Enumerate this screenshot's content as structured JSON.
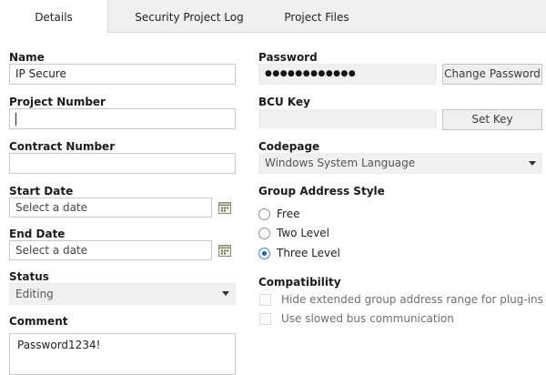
{
  "tabs": [
    {
      "label": "Details",
      "active": true
    },
    {
      "label": "Security Project Log",
      "active": false
    },
    {
      "label": "Project Files",
      "active": false
    }
  ],
  "left": {
    "name_label": "Name",
    "name_value": "IP Secure",
    "project_number_label": "Project Number",
    "project_number_value": "",
    "contract_number_label": "Contract Number",
    "contract_number_value": "",
    "start_date_label": "Start Date",
    "start_date_placeholder": "Select a date",
    "end_date_label": "End Date",
    "end_date_placeholder": "Select a date",
    "status_label": "Status",
    "status_value": "Editing",
    "comment_label": "Comment",
    "comment_value": "Password1234!"
  },
  "right": {
    "password_label": "Password",
    "password_mask": "●●●●●●●●●●●●",
    "change_password_button": "Change Password",
    "bcu_key_label": "BCU Key",
    "bcu_key_value": "",
    "set_key_button": "Set Key",
    "codepage_label": "Codepage",
    "codepage_value": "Windows System Language",
    "group_address_style_label": "Group Address Style",
    "group_address_options": [
      {
        "label": "Free",
        "checked": false
      },
      {
        "label": "Two Level",
        "checked": false
      },
      {
        "label": "Three Level",
        "checked": true
      }
    ],
    "compatibility_label": "Compatibility",
    "compatibility_options": [
      {
        "label": "Hide extended group address range for plug-ins",
        "checked": false,
        "enabled": false
      },
      {
        "label": "Use slowed bus communication",
        "checked": false,
        "enabled": false
      }
    ]
  },
  "icons": {
    "calendar": "calendar-icon",
    "dropdown": "chevron-down-icon"
  },
  "colors": {
    "tabbar_bg": "#f0f0f0",
    "field_border": "#c8c8c8",
    "disabled_field_bg": "#f0f0f0",
    "radio_checked": "#2b5d99"
  }
}
